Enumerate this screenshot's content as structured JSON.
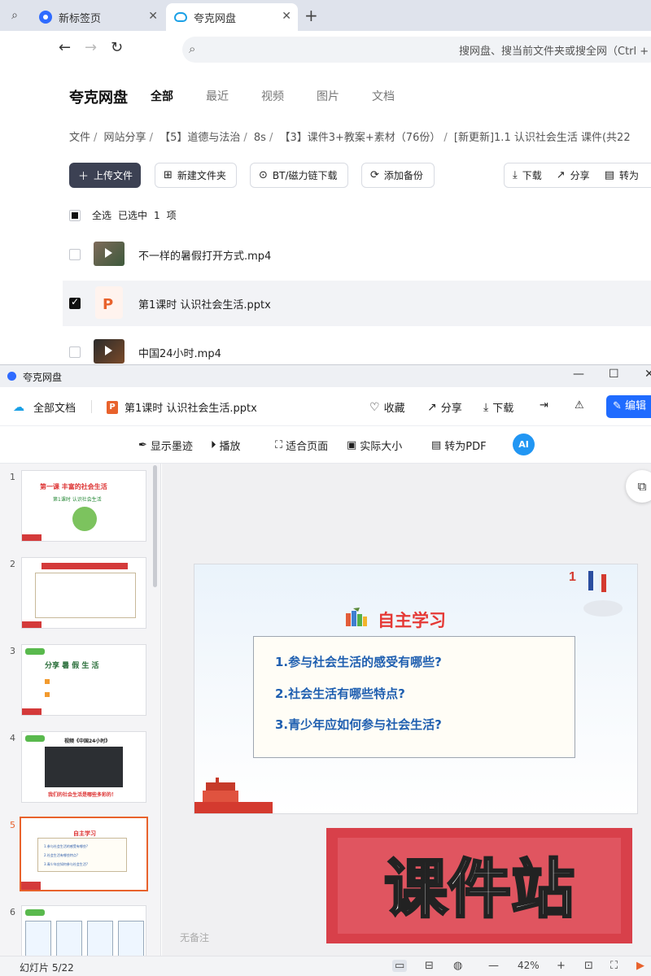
{
  "browser": {
    "tabs": [
      {
        "label": "新标签页",
        "active": false
      },
      {
        "label": "夸克网盘",
        "active": true
      }
    ],
    "address_placeholder": "搜网盘、搜当前文件夹或搜全网（Ctrl + F）"
  },
  "drive": {
    "brand": "夸克网盘",
    "nav_tabs": [
      "全部",
      "最近",
      "视频",
      "图片",
      "文档"
    ],
    "breadcrumb": [
      "文件",
      "网站分享",
      "【5】道德与法治",
      "8s",
      "【3】课件3+教案+素材（76份）",
      "[新更新]1.1 认识社会生活 课件(共22"
    ],
    "actions": {
      "upload": "上传文件",
      "new_folder": "新建文件夹",
      "bt": "BT/磁力链下载",
      "backup": "添加备份",
      "download": "下载",
      "share": "分享",
      "to_pdf": "转为"
    },
    "selection": {
      "select_all": "全选",
      "selected_prefix": "已选中",
      "count": "1",
      "unit": "项"
    },
    "files": [
      {
        "name": "不一样的暑假打开方式.mp4",
        "checked": false,
        "kind": "video"
      },
      {
        "name": "第1课时  认识社会生活.pptx",
        "checked": true,
        "kind": "ppt"
      },
      {
        "name": "中国24小时.mp4",
        "checked": false,
        "kind": "video"
      }
    ]
  },
  "viewer": {
    "window_title": "夸克网盘",
    "all_docs": "全部文档",
    "file_title": "第1课时 认识社会生活.pptx",
    "favorite": "收藏",
    "share": "分享",
    "download": "下载",
    "edit": "编辑",
    "tools": {
      "ink": "显示墨迹",
      "play": "播放",
      "fit": "适合页面",
      "actual": "实际大小",
      "to_pdf": "转为PDF",
      "ai": "AI"
    },
    "thumbnails": [
      {
        "num": "1",
        "title": "第一课  丰富的社会生活",
        "sub": "第1课时  认识社会生活"
      },
      {
        "num": "2",
        "title": "",
        "sub": ""
      },
      {
        "num": "3",
        "title": "分享 暑 假 生 活",
        "sub": ""
      },
      {
        "num": "4",
        "title": "视频《中国24小时》",
        "sub": "我们的社会生活是哪些多彩的！"
      },
      {
        "num": "5",
        "title": "自主学习",
        "sub": ""
      },
      {
        "num": "6",
        "title": "",
        "sub": ""
      }
    ],
    "current_slide": {
      "title": "自主学习",
      "questions": [
        "1.参与社会生活的感受有哪些?",
        "2.社会生活有哪些特点?",
        "3.青少年应如何参与社会生活?"
      ]
    },
    "mini_questions": [
      "1.参与社会生活的感受有哪些?",
      "2.社会生活有哪些特点?",
      "3.青少年应如何参与社会生活?"
    ],
    "watermark": "课件站",
    "no_notes": "无备注",
    "status": {
      "page": "幻灯片 5/22",
      "zoom": "42%"
    }
  },
  "colors": {
    "accent_blue": "#1f6bff",
    "slide_title_red": "#e53935",
    "question_blue": "#1f5fb0",
    "current_thumb": "#e8622c",
    "stamp_red": "#d8404a"
  }
}
